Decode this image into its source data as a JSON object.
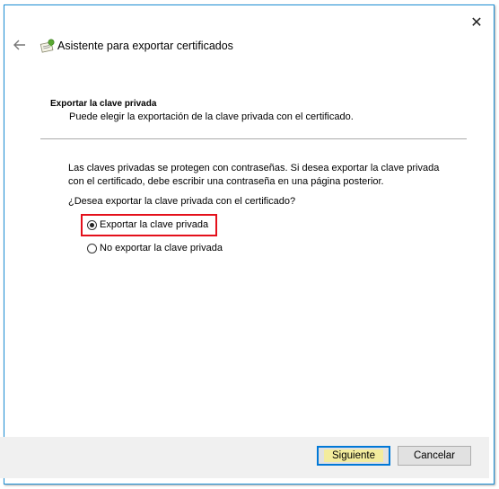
{
  "window": {
    "title": "Asistente para exportar certificados",
    "close_icon": "close-icon",
    "back_icon": "back-arrow-icon",
    "app_icon": "certificate-icon"
  },
  "section": {
    "title": "Exportar la clave privada",
    "subtitle": "Puede elegir la exportación de la clave privada con el certificado."
  },
  "info_text": "Las claves privadas se protegen con contraseñas. Si desea exportar la clave privada con el certificado, debe escribir una contraseña en una página posterior.",
  "question": "¿Desea exportar la clave privada con el certificado?",
  "options": [
    {
      "label": "Exportar la clave privada",
      "selected": true
    },
    {
      "label": "No exportar la clave privada",
      "selected": false
    }
  ],
  "buttons": {
    "next": "Siguiente",
    "cancel": "Cancelar"
  },
  "colors": {
    "accent": "#0078d7",
    "highlight": "#e4101b",
    "next_label_bg": "#f3ec9d",
    "footer_bg": "#f0f0f0"
  }
}
